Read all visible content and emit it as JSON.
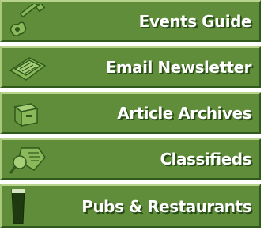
{
  "menu": {
    "items": [
      {
        "label": "Events Guide",
        "icon": "guitar-icon"
      },
      {
        "label": "Email Newsletter",
        "icon": "newsletter-icon"
      },
      {
        "label": "Article Archives",
        "icon": "archive-box-icon"
      },
      {
        "label": "Classifieds",
        "icon": "tag-magnifier-icon"
      },
      {
        "label": "Pubs & Restaurants",
        "icon": "pint-glass-icon"
      }
    ]
  },
  "colors": {
    "button_green": "#5f8d39",
    "highlight": "#b8d38c",
    "shadow": "#2f5a1b",
    "text": "#ffffff"
  }
}
